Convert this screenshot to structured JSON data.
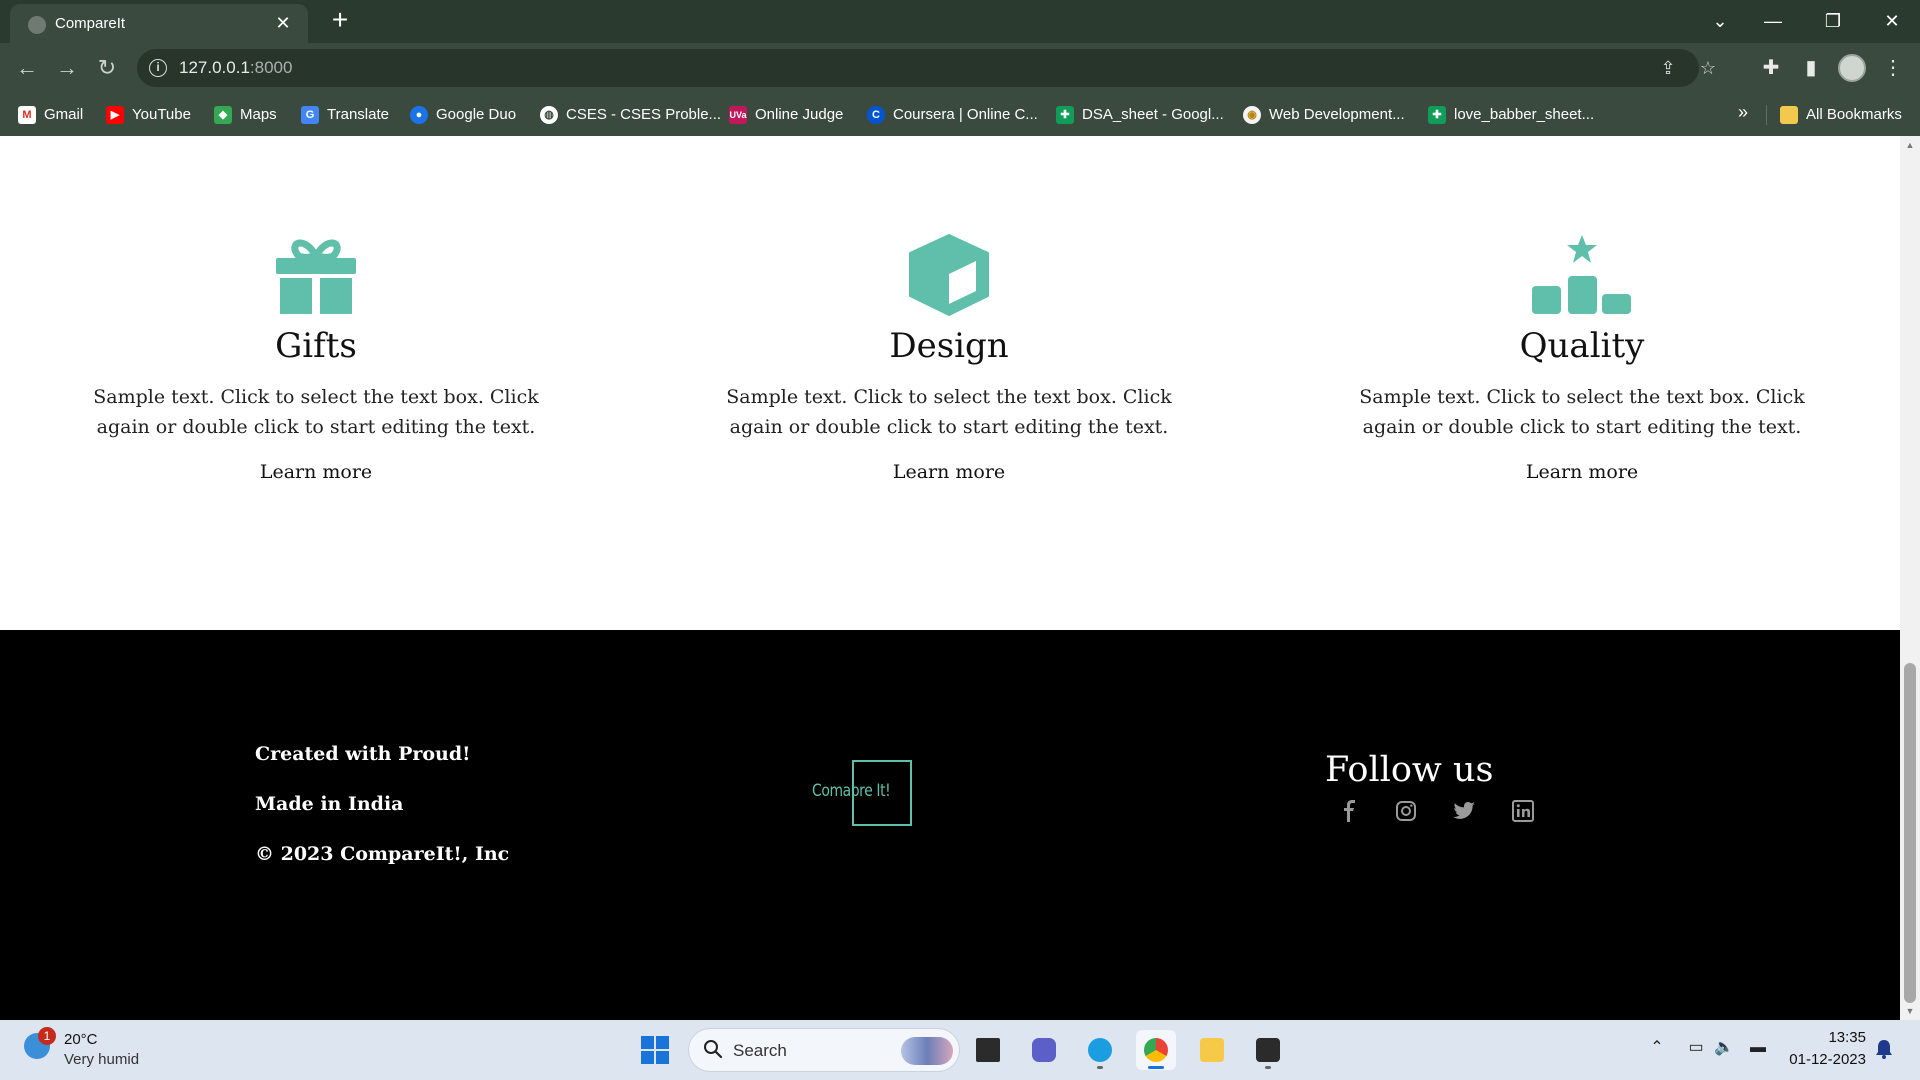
{
  "browser": {
    "tab_title": "CompareIt",
    "url_host": "127.0.0.1",
    "url_port": ":8000",
    "bookmarks": [
      "Gmail",
      "YouTube",
      "Maps",
      "Translate",
      "Google Duo",
      "CSES - CSES Proble...",
      "Online Judge",
      "Coursera | Online C...",
      "DSA_sheet - Googl...",
      "Web Development...",
      "love_babber_sheet..."
    ],
    "bookmarks_more": "»",
    "all_bookmarks": "All Bookmarks"
  },
  "features": [
    {
      "icon": "gift-icon",
      "title": "Gifts",
      "text": "Sample text. Click to select the text box. Click again or double click to start editing the text.",
      "link": "Learn more"
    },
    {
      "icon": "cube-icon",
      "title": "Design",
      "text": "Sample text. Click to select the text box. Click again or double click to start editing the text.",
      "link": "Learn more"
    },
    {
      "icon": "podium-star-icon",
      "title": "Quality",
      "text": "Sample text. Click to select the text box. Click again or double click to start editing the text.",
      "link": "Learn more"
    }
  ],
  "footer": {
    "lines": [
      "Created with Proud!",
      "Made in India",
      "© 2023 CompareIt!, Inc"
    ],
    "logo_text": "Comapre It!",
    "follow_title": "Follow us",
    "social": [
      "facebook-icon",
      "instagram-icon",
      "twitter-icon",
      "linkedin-icon"
    ]
  },
  "taskbar": {
    "weather_badge": "1",
    "temperature": "20°C",
    "weather_desc": "Very humid",
    "search_placeholder": "Search",
    "time": "13:35",
    "date": "01-12-2023"
  },
  "colors": {
    "accent": "#5fbfab",
    "footer_bg": "#000000",
    "chrome_bg": "#3a4a3e"
  }
}
